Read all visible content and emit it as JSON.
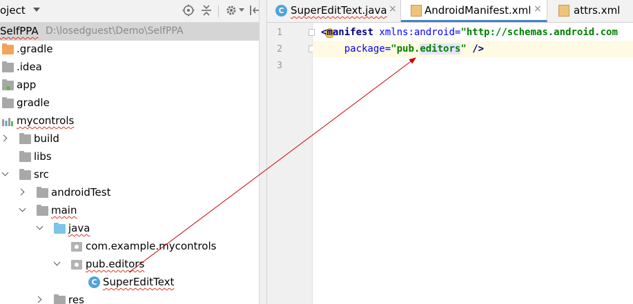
{
  "project_panel": {
    "title": "oject",
    "tree": [
      {
        "label": "SelfPPA",
        "path": "D:\\losedguest\\Demo\\SelfPPA",
        "icon": "none",
        "selected": true
      },
      {
        "label": ".gradle",
        "icon": "folder-orange-icon"
      },
      {
        "label": ".idea",
        "icon": "folder-icon"
      },
      {
        "label": "app",
        "icon": "app-module-icon"
      },
      {
        "label": "gradle",
        "icon": "folder-icon"
      },
      {
        "label": "mycontrols",
        "icon": "library-module-icon"
      },
      {
        "label": "build",
        "icon": "folder-icon",
        "chevron": "right"
      },
      {
        "label": "libs",
        "icon": "folder-icon"
      },
      {
        "label": "src",
        "icon": "folder-icon",
        "chevron": "down"
      },
      {
        "label": "androidTest",
        "icon": "folder-icon",
        "chevron": "right"
      },
      {
        "label": "main",
        "icon": "folder-icon",
        "chevron": "down"
      },
      {
        "label": "java",
        "icon": "folder-blue-icon",
        "chevron": "down"
      },
      {
        "label": "com.example.mycontrols",
        "icon": "package-icon"
      },
      {
        "label": "pub.editors",
        "icon": "package-icon",
        "chevron": "down"
      },
      {
        "label": "SuperEditText",
        "icon": "class-icon"
      },
      {
        "label": "res",
        "icon": "folder-icon",
        "chevron": "right"
      }
    ]
  },
  "editor": {
    "tabs": [
      {
        "label": "SuperEditText.java",
        "icon": "java-class-icon",
        "close": "×",
        "active": false
      },
      {
        "label": "AndroidManifest.xml",
        "icon": "xml-file-icon",
        "close": "×",
        "active": true
      },
      {
        "label": "attrs.xml",
        "icon": "xml-file-icon",
        "active": false
      }
    ],
    "line_numbers": [
      "1",
      "2",
      "3"
    ],
    "code": {
      "line1_lt": "<",
      "line1_tag": "manifest",
      "line1_attr": " xmlns:android=",
      "line1_val": "\"http://schemas.android.com",
      "line2_indent": "    ",
      "line2_attr": "package=",
      "line2_q1": "\"",
      "line2_val_a": "pub.",
      "line2_val_b": "editors",
      "line2_q2": "\"",
      "line2_end": " />"
    },
    "class_icon_letter": "C"
  },
  "colors": {
    "annotation_arrow": "#cc0000",
    "active_tab_underline": "#4083c9",
    "selection": "#d5d5d5",
    "current_line": "#fffae3"
  }
}
